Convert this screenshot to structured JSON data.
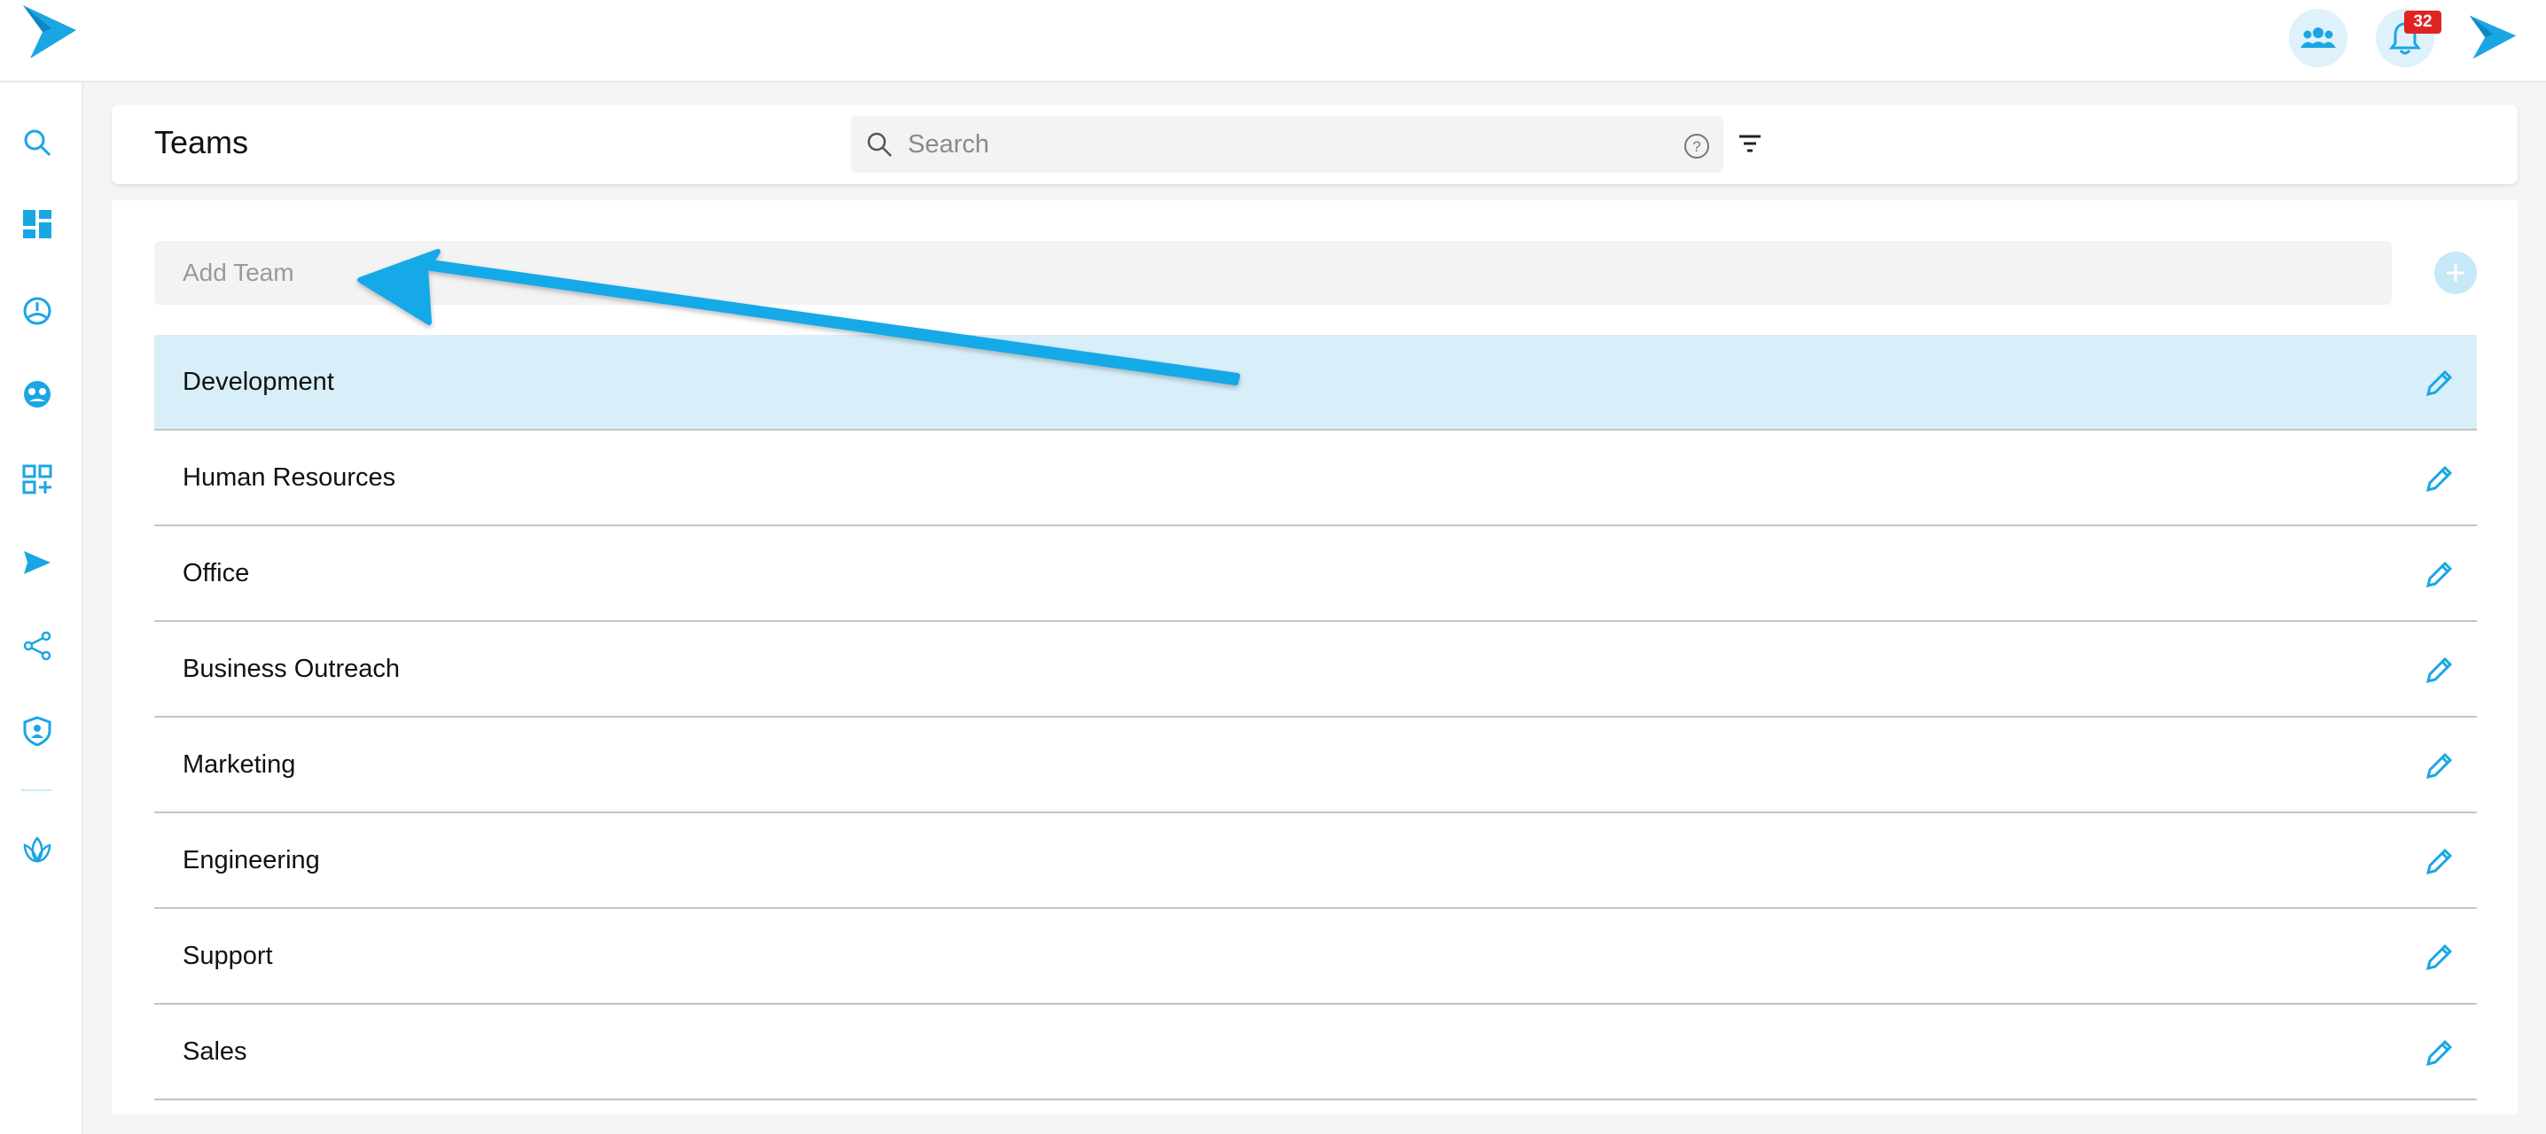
{
  "header": {
    "title": "Teams",
    "search_placeholder": "Search",
    "notification_count": "32"
  },
  "icons": {
    "logo": "paper-plane-logo-icon",
    "team": "team-icon",
    "bell": "bell-icon",
    "search": "search-icon",
    "help": "help-icon",
    "filter": "filter-icon",
    "add": "plus-icon",
    "edit": "pencil-icon"
  },
  "sidebar": {
    "items": [
      "search",
      "dashboard",
      "dial",
      "faces",
      "apps-add",
      "send",
      "share",
      "shield",
      "lotus"
    ]
  },
  "teams": {
    "add_placeholder": "Add Team",
    "items": [
      {
        "name": "Development",
        "selected": true
      },
      {
        "name": "Human Resources",
        "selected": false
      },
      {
        "name": "Office",
        "selected": false
      },
      {
        "name": "Business Outreach",
        "selected": false
      },
      {
        "name": "Marketing",
        "selected": false
      },
      {
        "name": "Engineering",
        "selected": false
      },
      {
        "name": "Support",
        "selected": false
      },
      {
        "name": "Sales",
        "selected": false
      }
    ]
  },
  "colors": {
    "accent": "#1aa6e4",
    "selected_row": "#d8eff9",
    "badge": "#e02424",
    "arrow": "#12a9e8"
  }
}
